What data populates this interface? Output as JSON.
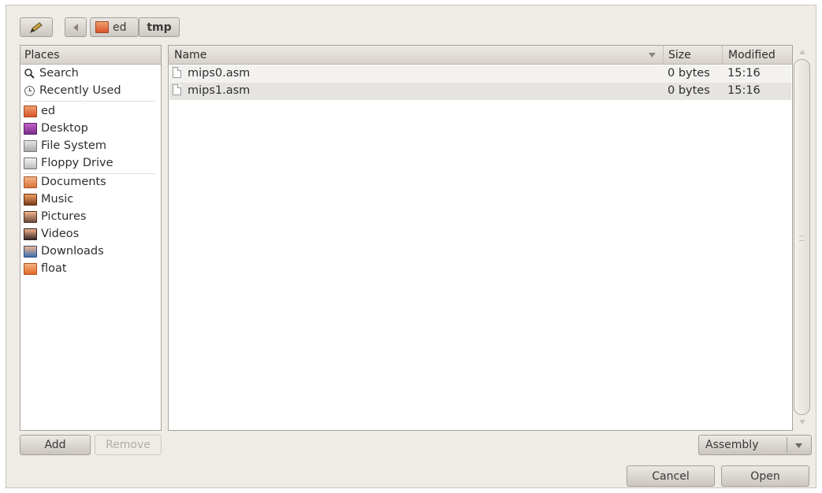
{
  "toolbar": {
    "edit_icon": "pencil-icon",
    "back_icon": "back-arrow-icon",
    "path": [
      {
        "label": "ed",
        "icon": "home-folder-icon"
      },
      {
        "label": "tmp"
      }
    ]
  },
  "places": {
    "header": "Places",
    "items": [
      {
        "label": "Search",
        "icon": "magnifier-icon"
      },
      {
        "label": "Recently Used",
        "icon": "clock-icon"
      },
      {
        "label": "ed",
        "icon": "home-folder-icon"
      },
      {
        "label": "Desktop",
        "icon": "desktop-icon"
      },
      {
        "label": "File System",
        "icon": "drive-icon"
      },
      {
        "label": "Floppy Drive",
        "icon": "floppy-icon"
      },
      {
        "label": "Documents",
        "icon": "documents-folder-icon"
      },
      {
        "label": "Music",
        "icon": "music-folder-icon"
      },
      {
        "label": "Pictures",
        "icon": "pictures-folder-icon"
      },
      {
        "label": "Videos",
        "icon": "videos-folder-icon"
      },
      {
        "label": "Downloads",
        "icon": "downloads-folder-icon"
      },
      {
        "label": "float",
        "icon": "folder-icon"
      }
    ],
    "add_label": "Add",
    "remove_label": "Remove"
  },
  "files": {
    "columns": {
      "name": "Name",
      "size": "Size",
      "modified": "Modified"
    },
    "rows": [
      {
        "name": "mips0.asm",
        "size": "0 bytes",
        "modified": "15:16"
      },
      {
        "name": "mips1.asm",
        "size": "0 bytes",
        "modified": "15:16"
      }
    ]
  },
  "filter": {
    "selected": "Assembly"
  },
  "actions": {
    "cancel_label": "Cancel",
    "open_label": "Open"
  },
  "colors": {
    "accent_folder": "#e8743b",
    "selection": "#e6e4e1"
  }
}
